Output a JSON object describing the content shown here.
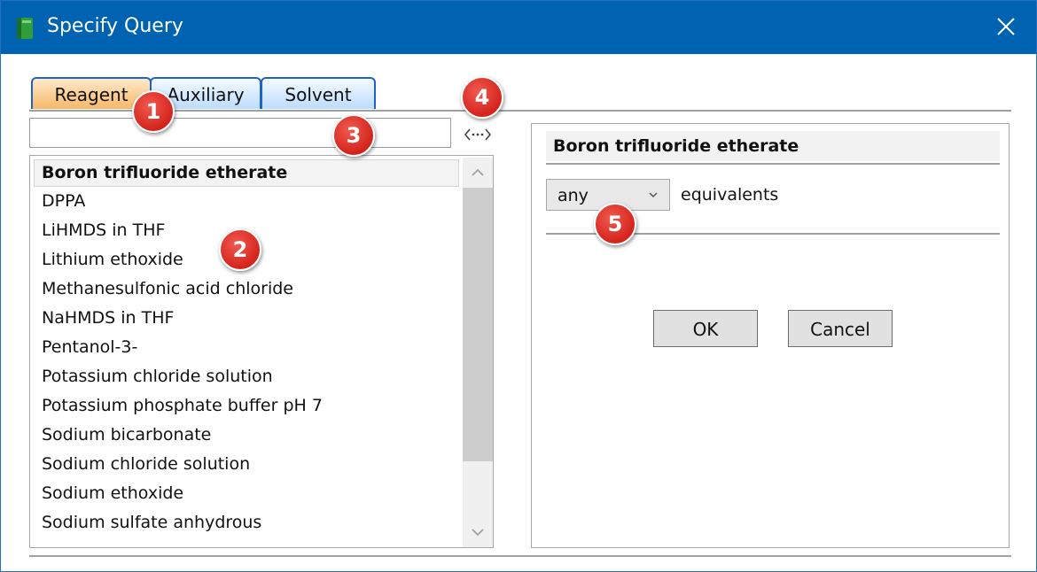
{
  "window": {
    "title": "Specify Query",
    "accent_color": "#0063b1",
    "icons": {
      "app": "green-book-icon",
      "close": "close-icon"
    }
  },
  "tabs": [
    {
      "label": "Reagent",
      "active": true
    },
    {
      "label": "Auxiliary",
      "active": false
    },
    {
      "label": "Solvent",
      "active": false
    }
  ],
  "search": {
    "value": "",
    "placeholder": ""
  },
  "splitter": {
    "icon": "horizontal-resize-icon"
  },
  "list": {
    "items": [
      "Boron trifluoride etherate",
      "DPPA",
      "LiHMDS in THF",
      "Lithium ethoxide",
      "Methanesulfonic acid chloride",
      "NaHMDS in THF",
      "Pentanol-3-",
      "Potassium chloride solution",
      "Potassium phosphate buffer pH 7",
      "Sodium bicarbonate",
      "Sodium chloride solution",
      "Sodium ethoxide",
      "Sodium sulfate anhydrous"
    ],
    "selected": "Boron trifluoride etherate"
  },
  "detail": {
    "header": "Boron trifluoride etherate",
    "equivalents": {
      "selected": "any",
      "label": "equivalents"
    },
    "ok_label": "OK",
    "cancel_label": "Cancel"
  },
  "callouts": [
    "1",
    "2",
    "3",
    "4",
    "5"
  ],
  "colors": {
    "active_tab": "#f7b86a",
    "inactive_tab": "#bcdcff",
    "tab_border": "#1e64c8",
    "badge": "#d4241c"
  }
}
